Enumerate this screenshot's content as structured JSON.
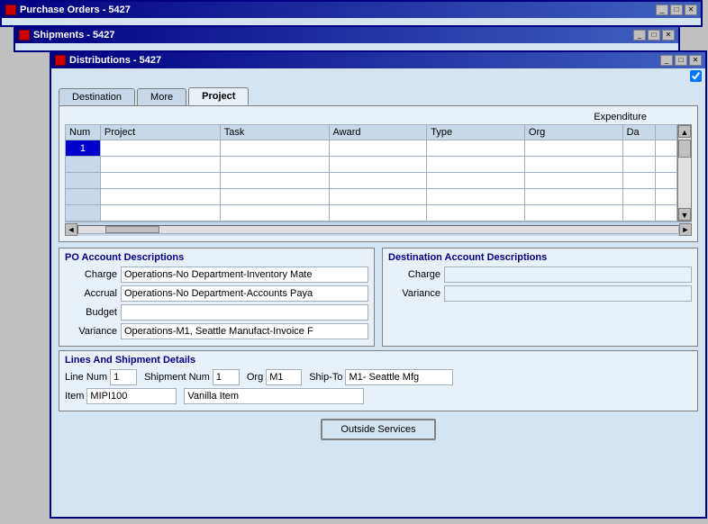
{
  "windows": {
    "po": {
      "title": "Purchase Orders - 5427",
      "buttons": [
        "_",
        "□",
        "✕"
      ]
    },
    "shipments": {
      "title": "Shipments - 5427",
      "buttons": [
        "_",
        "□",
        "✕"
      ]
    },
    "distributions": {
      "title": "Distributions - 5427",
      "buttons": [
        "_",
        "□",
        "✕"
      ]
    }
  },
  "tabs": [
    {
      "id": "destination",
      "label": "Destination"
    },
    {
      "id": "more",
      "label": "More"
    },
    {
      "id": "project",
      "label": "Project"
    }
  ],
  "active_tab": "project",
  "expenditure": {
    "header": "Expenditure"
  },
  "table": {
    "columns": [
      "Num",
      "Project",
      "Task",
      "Award",
      "Type",
      "Org",
      "Da",
      ""
    ],
    "rows": [
      {
        "num": "1",
        "project": "",
        "task": "",
        "award": "",
        "type": "",
        "org": "",
        "da": "",
        "extra": ""
      },
      {
        "num": "",
        "project": "",
        "task": "",
        "award": "",
        "type": "",
        "org": "",
        "da": "",
        "extra": ""
      },
      {
        "num": "",
        "project": "",
        "task": "",
        "award": "",
        "type": "",
        "org": "",
        "da": "",
        "extra": ""
      },
      {
        "num": "",
        "project": "",
        "task": "",
        "award": "",
        "type": "",
        "org": "",
        "da": "",
        "extra": ""
      },
      {
        "num": "",
        "project": "",
        "task": "",
        "award": "",
        "type": "",
        "org": "",
        "da": "",
        "extra": ""
      }
    ]
  },
  "po_account": {
    "title": "PO Account Descriptions",
    "fields": [
      {
        "label": "Charge",
        "value": "Operations-No Department-Inventory Mate"
      },
      {
        "label": "Accrual",
        "value": "Operations-No Department-Accounts Paya"
      },
      {
        "label": "Budget",
        "value": ""
      },
      {
        "label": "Variance",
        "value": "Operations-M1, Seattle Manufact-Invoice F"
      }
    ]
  },
  "destination_account": {
    "title": "Destination Account Descriptions",
    "fields": [
      {
        "label": "Charge",
        "value": ""
      },
      {
        "label": "Variance",
        "value": ""
      }
    ]
  },
  "lines_shipment": {
    "title": "Lines And Shipment Details",
    "line_num_label": "Line Num",
    "line_num": "1",
    "shipment_num_label": "Shipment Num",
    "shipment_num": "1",
    "org_label": "Org",
    "org": "M1",
    "ship_to_label": "Ship-To",
    "ship_to": "M1- Seattle Mfg",
    "item_label": "Item",
    "item": "MIPI100",
    "item_desc": "Vanilla Item"
  },
  "buttons": {
    "outside_services": "Outside Services"
  },
  "checkmark": "✔"
}
